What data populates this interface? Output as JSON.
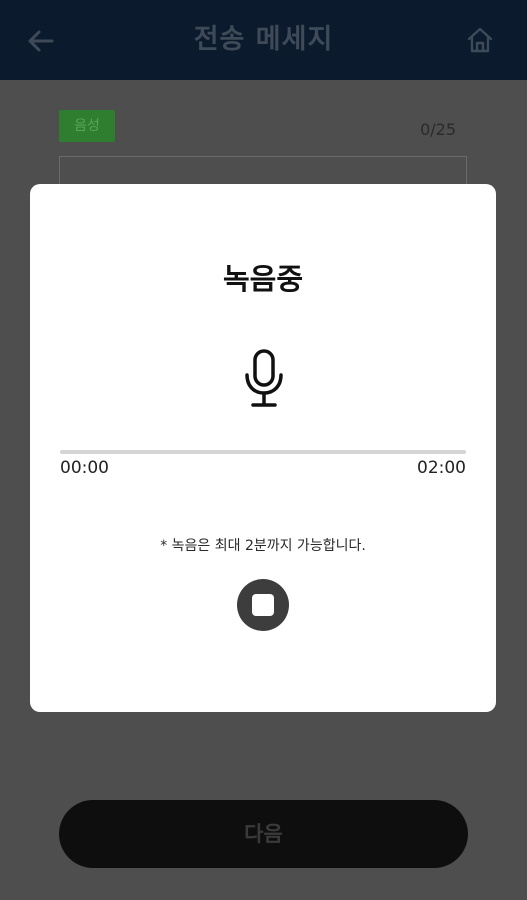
{
  "header": {
    "title": "전송 메세지",
    "back_icon": "arrow-left-icon",
    "home_icon": "home-icon"
  },
  "background": {
    "badge_label": "음성",
    "char_counter": "0/25",
    "next_button_label": "다음"
  },
  "modal": {
    "title": "녹음중",
    "mic_icon": "microphone-icon",
    "progress": {
      "fraction": 0.0
    },
    "time_elapsed": "00:00",
    "time_total": "02:00",
    "notice": "* 녹음은 최대 2분까지 가능합니다.",
    "stop_icon": "stop-icon"
  },
  "colors": {
    "header_bg": "#0b1a2c",
    "overlay_bg": "#4e4e4e",
    "badge_green": "#2f7d2f",
    "stop_button": "#3d3d3d"
  }
}
